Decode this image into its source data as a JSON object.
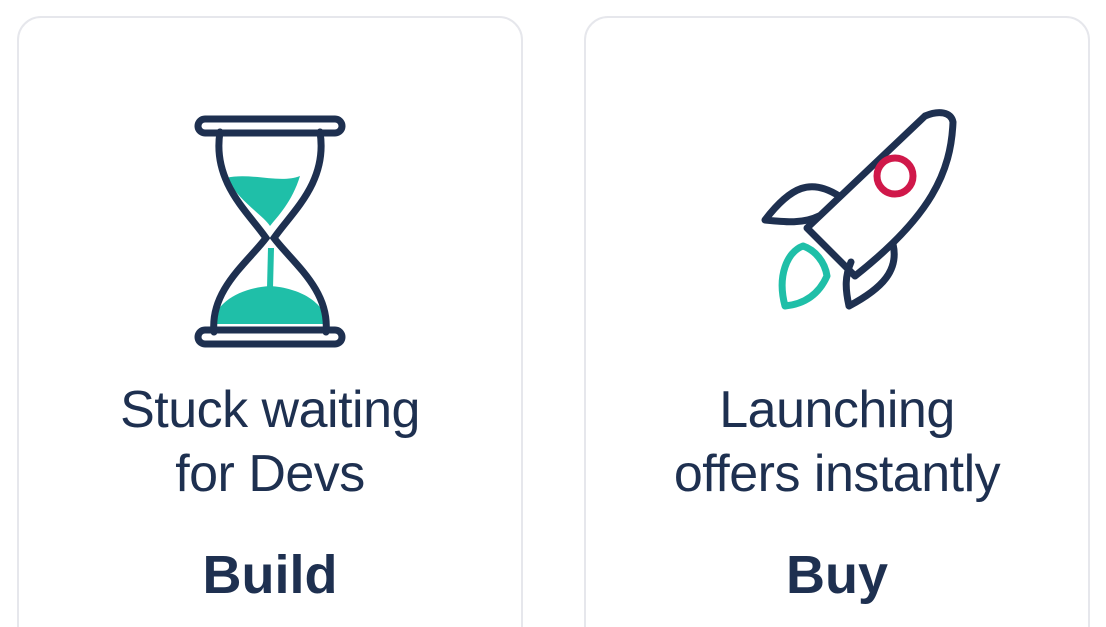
{
  "colors": {
    "navy": "#1e3050",
    "teal": "#1fbfa8",
    "red": "#d0184a",
    "card_border": "#e6e7ec"
  },
  "cards": [
    {
      "icon": "hourglass-icon",
      "description_line1": "Stuck waiting",
      "description_line2": "for Devs",
      "title": "Build"
    },
    {
      "icon": "rocket-icon",
      "description_line1": "Launching",
      "description_line2": "offers instantly",
      "title": "Buy"
    }
  ]
}
